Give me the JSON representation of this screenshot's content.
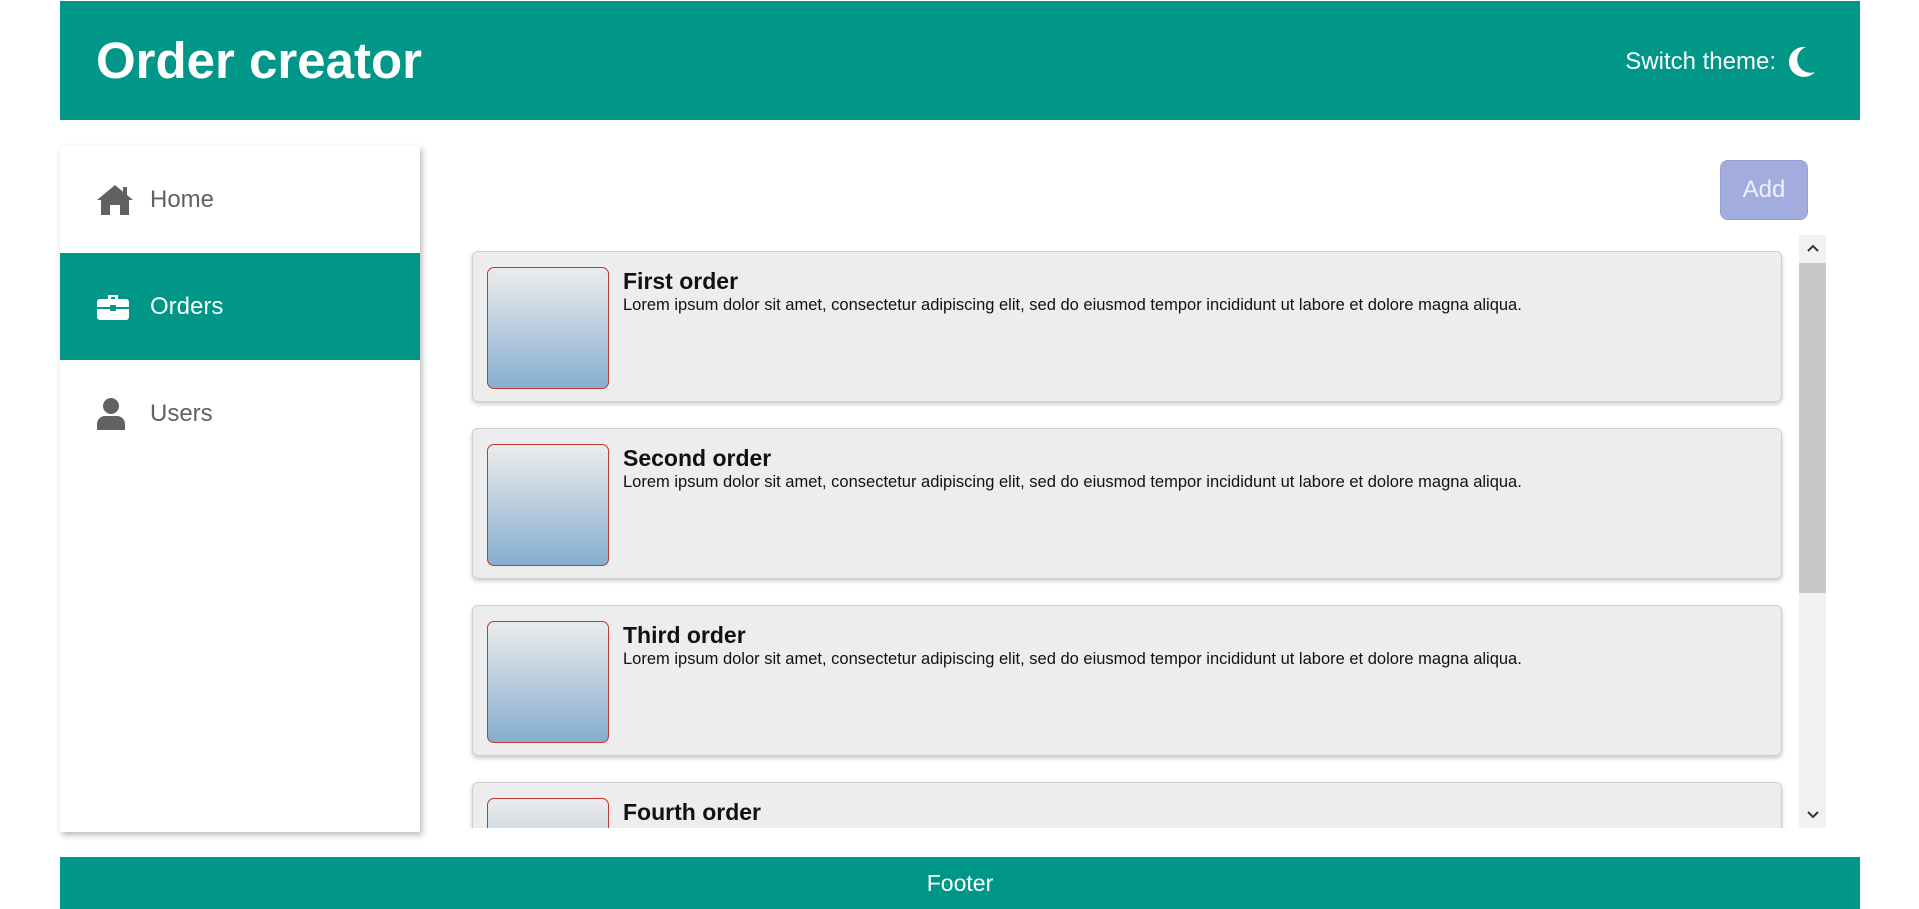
{
  "header": {
    "title": "Order creator",
    "switch_theme_label": "Switch theme:",
    "theme_icon": "moon-icon"
  },
  "sidebar": {
    "items": [
      {
        "label": "Home",
        "icon": "home-icon",
        "active": false
      },
      {
        "label": "Orders",
        "icon": "briefcase-icon",
        "active": true
      },
      {
        "label": "Users",
        "icon": "user-icon",
        "active": false
      }
    ]
  },
  "toolbar": {
    "add_label": "Add"
  },
  "orders": [
    {
      "title": "First order",
      "description": "Lorem ipsum dolor sit amet, consectetur adipiscing elit, sed do eiusmod tempor incididunt ut labore et dolore magna aliqua."
    },
    {
      "title": "Second order",
      "description": "Lorem ipsum dolor sit amet, consectetur adipiscing elit, sed do eiusmod tempor incididunt ut labore et dolore magna aliqua."
    },
    {
      "title": "Third order",
      "description": "Lorem ipsum dolor sit amet, consectetur adipiscing elit, sed do eiusmod tempor incididunt ut labore et dolore magna aliqua."
    },
    {
      "title": "Fourth order",
      "description": ""
    }
  ],
  "footer": {
    "label": "Footer"
  },
  "colors": {
    "primary": "#009688",
    "add_button": "#a3acdf",
    "card_background": "#ededed",
    "thumbnail_border": "#c0392b"
  }
}
